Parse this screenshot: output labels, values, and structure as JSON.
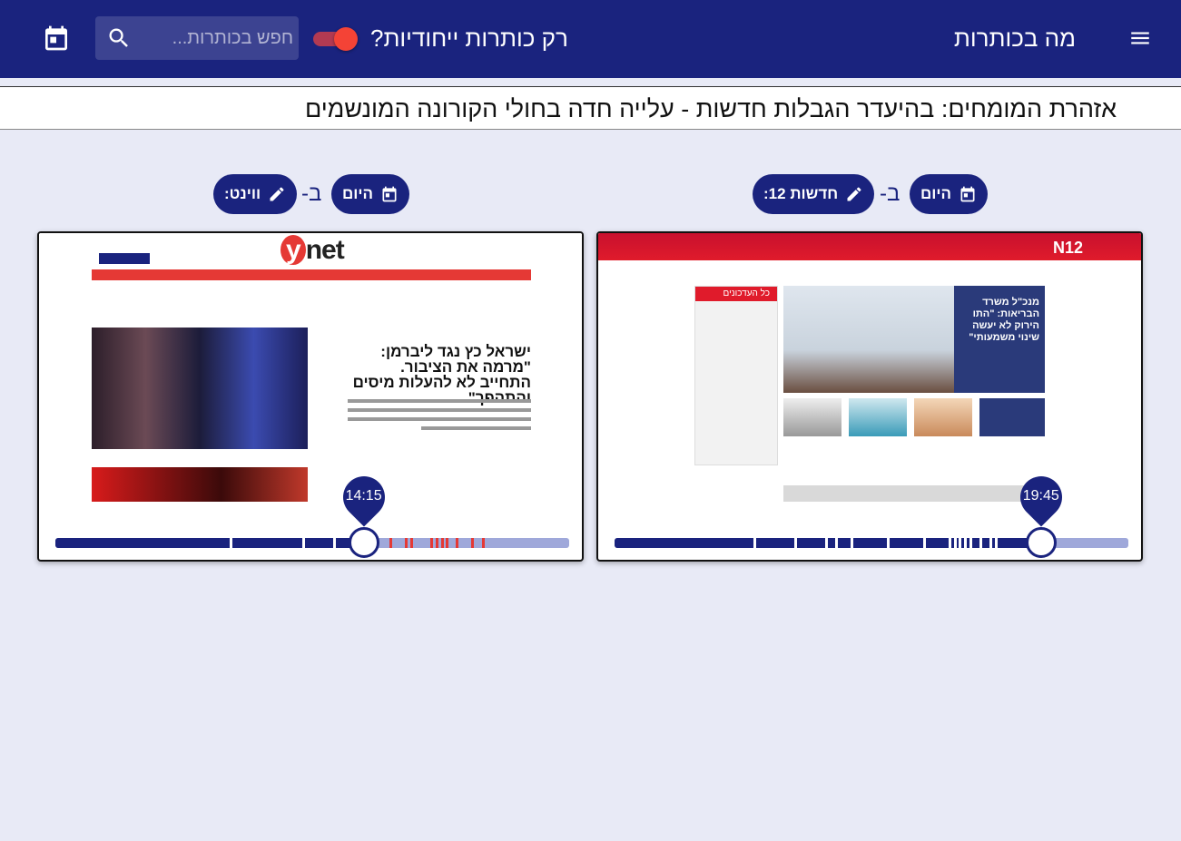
{
  "appbar": {
    "title": "מה בכותרות",
    "toggle_label": "רק כותרות ייחודיות?",
    "toggle_on": true,
    "search_placeholder": "חפש בכותרות..."
  },
  "ticker": {
    "text": "אזהרת המומחים: בהיעדר הגבלות חדשות - עלייה חדה בחולי הקורונה המונשמים"
  },
  "left_panel": {
    "date_chip": "היום",
    "separator": "ב-",
    "site_chip": "חדשות 12",
    "time": "19:45",
    "progress": 0.83,
    "ticks": [
      0.27,
      0.35,
      0.41,
      0.43,
      0.46,
      0.53,
      0.6,
      0.65,
      0.66,
      0.67,
      0.68,
      0.69,
      0.71,
      0.73,
      0.74
    ],
    "screenshot": {
      "logo": "N12",
      "headline": "מנכ\"ל משרד הבריאות: \"התו הירוק לא יעשה שינוי משמעותי\"",
      "side_title": "כל העדכונים"
    }
  },
  "right_panel": {
    "date_chip": "היום",
    "separator": "ב-",
    "site_chip": "ווינט",
    "time": "14:15",
    "progress": 0.6,
    "ticks": [
      0.34,
      0.48,
      0.54
    ],
    "red_ticks": [
      0.65,
      0.68,
      0.69,
      0.73,
      0.74,
      0.75,
      0.76,
      0.78,
      0.81,
      0.83
    ],
    "screenshot": {
      "logo": "net",
      "logo_y": "y",
      "headline": "ישראל כץ נגד ליברמן: \"מרמה את הציבור. התחייב לא להעלות מיסים והתהפך\""
    }
  },
  "colors": {
    "primary": "#1a237e",
    "track": "#9fa8da",
    "accent": "#f44336",
    "background": "#e8eaf6"
  }
}
